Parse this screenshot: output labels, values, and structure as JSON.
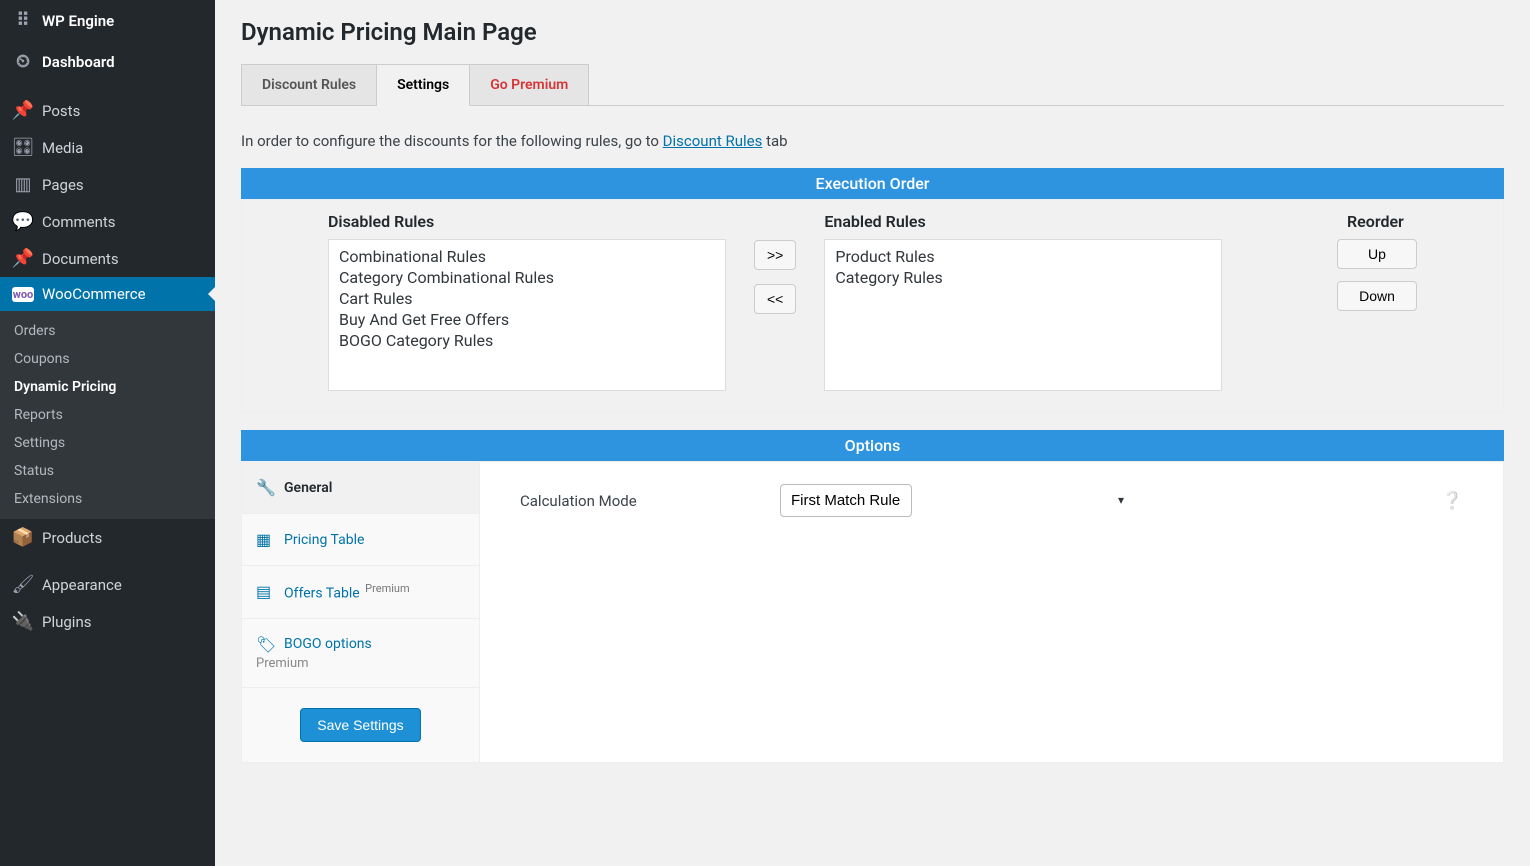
{
  "sidebar": {
    "topItems": [
      {
        "icon": "⠿",
        "label": "WP Engine"
      },
      {
        "icon": "⏲",
        "label": "Dashboard"
      },
      {
        "icon": "📌",
        "label": "Posts"
      },
      {
        "icon": "🎛",
        "label": "Media"
      },
      {
        "icon": "▥",
        "label": "Pages"
      },
      {
        "icon": "💬",
        "label": "Comments"
      },
      {
        "icon": "📌",
        "label": "Documents"
      }
    ],
    "woo": {
      "label": "WooCommerce",
      "sub": [
        "Orders",
        "Coupons",
        "Dynamic Pricing",
        "Reports",
        "Settings",
        "Status",
        "Extensions"
      ],
      "activeSub": "Dynamic Pricing"
    },
    "bottomItems": [
      {
        "icon": "📦",
        "label": "Products"
      },
      {
        "icon": "🖌",
        "label": "Appearance"
      },
      {
        "icon": "🔌",
        "label": "Plugins"
      }
    ]
  },
  "page": {
    "title": "Dynamic Pricing Main Page",
    "tabs": [
      {
        "label": "Discount Rules",
        "active": false,
        "premium": false
      },
      {
        "label": "Settings",
        "active": true,
        "premium": false
      },
      {
        "label": "Go Premium",
        "active": false,
        "premium": true
      }
    ],
    "intro_prefix": "In order to configure the discounts for the following rules, go to ",
    "intro_link": "Discount Rules",
    "intro_suffix": " tab"
  },
  "execution": {
    "header": "Execution Order",
    "disabled_label": "Disabled Rules",
    "enabled_label": "Enabled Rules",
    "reorder_label": "Reorder",
    "disabled": [
      "Combinational Rules",
      "Category Combinational Rules",
      "Cart Rules",
      "Buy And Get Free Offers",
      "BOGO Category Rules"
    ],
    "enabled": [
      "Product Rules",
      "Category Rules"
    ],
    "move_right": ">>",
    "move_left": "<<",
    "up": "Up",
    "down": "Down"
  },
  "options": {
    "header": "Options",
    "nav": [
      {
        "icon": "🔧",
        "label": "General",
        "active": true
      },
      {
        "icon": "▦",
        "label": "Pricing Table",
        "link": true
      },
      {
        "icon": "▤",
        "label": "Offers Table",
        "link": true,
        "sup": "Premium"
      },
      {
        "icon": "🏷",
        "label": "BOGO options",
        "link": true,
        "sub": "Premium"
      }
    ],
    "save_btn": "Save Settings",
    "calc_label": "Calculation Mode",
    "calc_value": "First Match Rule"
  },
  "colors": {
    "accent": "#2f94e0",
    "link": "#0073aa",
    "premium": "#d63638"
  }
}
